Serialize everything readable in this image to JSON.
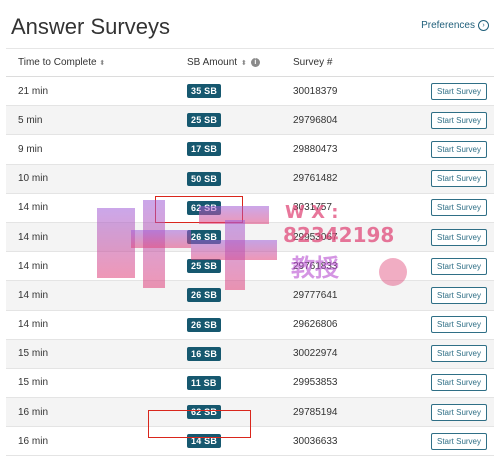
{
  "page": {
    "title": "Answer Surveys",
    "preferences_label": "Preferences"
  },
  "table": {
    "headers": {
      "time": "Time to Complete",
      "amount": "SB Amount",
      "survey": "Survey #"
    },
    "button_label": "Start Survey",
    "rows": [
      {
        "time": "21 min",
        "amount": "35 SB",
        "survey": "30018379"
      },
      {
        "time": "5 min",
        "amount": "25 SB",
        "survey": "29796804"
      },
      {
        "time": "9 min",
        "amount": "17 SB",
        "survey": "29880473"
      },
      {
        "time": "10 min",
        "amount": "50 SB",
        "survey": "29761482"
      },
      {
        "time": "14 min",
        "amount": "62 SB",
        "survey": "3031757"
      },
      {
        "time": "14 min",
        "amount": "26 SB",
        "survey": "29953067"
      },
      {
        "time": "14 min",
        "amount": "25 SB",
        "survey": "29761833"
      },
      {
        "time": "14 min",
        "amount": "26 SB",
        "survey": "29777641"
      },
      {
        "time": "14 min",
        "amount": "26 SB",
        "survey": "29626806"
      },
      {
        "time": "15 min",
        "amount": "16 SB",
        "survey": "30022974"
      },
      {
        "time": "15 min",
        "amount": "11 SB",
        "survey": "29953853"
      },
      {
        "time": "16 min",
        "amount": "62 SB",
        "survey": "29785194"
      },
      {
        "time": "16 min",
        "amount": "14 SB",
        "survey": "30036633"
      }
    ]
  },
  "watermark": {
    "text_wx": "W X :",
    "text_number": "82342198",
    "text_cn": "教授"
  },
  "colors": {
    "badge": "#16586f",
    "button_border": "#2f6f86",
    "highlight": "#d9261c"
  }
}
